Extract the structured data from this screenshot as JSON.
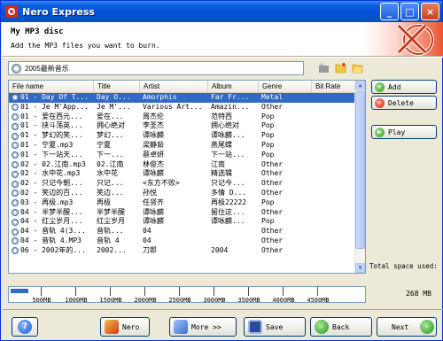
{
  "window": {
    "title": "Nero Express"
  },
  "header": {
    "title": "My MP3 disc",
    "subtitle": "Add the MP3 files you want to burn."
  },
  "compilation": {
    "name": "2005最新音乐"
  },
  "columns": [
    "File name",
    "Title",
    "Artist",
    "Album",
    "Genre",
    "Bit Rate"
  ],
  "rows": [
    [
      "01 - Day Of T...",
      "Day O...",
      "Amorphis",
      "Far Fr...",
      "Metal",
      ""
    ],
    [
      "01 - Je M'App...",
      "Je M'...",
      "Various Art...",
      "Amazin...",
      "Other",
      ""
    ],
    [
      "01 - 爱在西元...",
      "爱在...",
      "周杰伦",
      "范特西",
      "Pop",
      ""
    ],
    [
      "01 - 挟斗荡英...",
      "拥心绝对",
      "李圣杰",
      "拥心绝对",
      "Pop",
      ""
    ],
    [
      "01 - 梦幻的笑...",
      "梦幻...",
      "谭咏麟",
      "谭咏麟...",
      "Pop",
      ""
    ],
    [
      "01 - 宁夏.mp3",
      "宁夏",
      "梁静茹",
      "燕尾蝶",
      "Pop",
      ""
    ],
    [
      "01 - 下一站天...",
      "下一...",
      "蔡卓妍",
      "下一站...",
      "Pop",
      ""
    ],
    [
      "02 - 02.江南.mp3",
      "02.江南",
      "林俊杰",
      "江南",
      "Other",
      ""
    ],
    [
      "02 - 水中花.mp3",
      "水中花",
      "谭咏麟",
      "精选辑",
      "Other",
      ""
    ],
    [
      "02 - 只记今朝...",
      "只记...",
      "<东方不败>",
      "只记今...",
      "Other",
      ""
    ],
    [
      "02 - 笑边的百...",
      "笑边...",
      "孙悦",
      "多情 D...",
      "Other",
      ""
    ],
    [
      "03 - 再极.mp3",
      "再极",
      "任贤齐",
      "再极22222",
      "Pop",
      ""
    ],
    [
      "04 - 半梦半醒...",
      "半梦半醒",
      "谭咏麟",
      "留住这...",
      "Other",
      ""
    ],
    [
      "04 - 红尘岁月...",
      "红尘岁月",
      "谭咏麟",
      "谭咏麟...",
      "Pop",
      ""
    ],
    [
      "04 - 音轨 4(3...",
      "音轨...",
      "04",
      "",
      "Other",
      ""
    ],
    [
      "04 - 音轨 4.MP3",
      "音轨 4",
      "04",
      "",
      "Other",
      ""
    ],
    [
      "06 - 2002年的...",
      "2002...",
      "刀郎",
      "2004",
      "Other",
      ""
    ]
  ],
  "buttons": {
    "add": "Add",
    "delete": "Delete",
    "play": "Play",
    "nero": "Nero",
    "more": "More >>",
    "save": "Save",
    "back": "Back",
    "next": "Next"
  },
  "total_space": {
    "label": "Total space used:",
    "value": "268 MB"
  },
  "capacity_ticks": [
    "500MB",
    "1000MB",
    "1500MB",
    "2000MB",
    "2500MB",
    "3000MB",
    "3500MB",
    "4000MB",
    "4500MB"
  ],
  "colors": {
    "titlebar": "#0553d4",
    "selection": "#316ac5",
    "accent": "#e8552f"
  },
  "icons": {
    "window": "nero-app-icon",
    "disc": "disc-icon",
    "help": "help-icon",
    "add": "green-plus-icon",
    "delete": "red-minus-icon",
    "play": "green-play-icon",
    "nero": "nero-icon",
    "more": "more-icon",
    "save": "save-icon",
    "back": "back-arrow-icon",
    "next": "next-arrow-icon"
  }
}
